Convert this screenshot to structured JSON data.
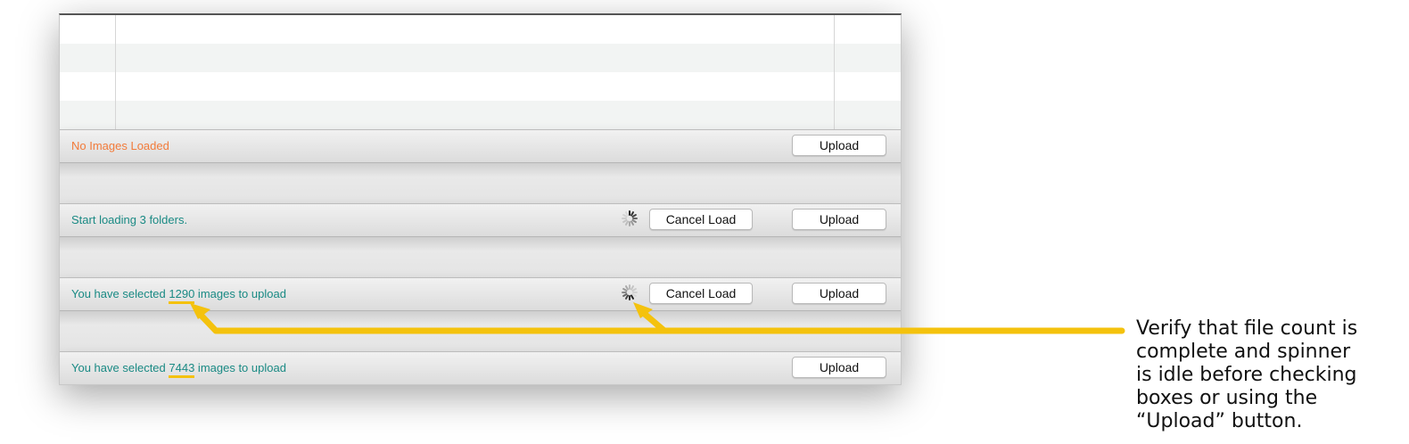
{
  "panels": [
    {
      "status": "No Images Loaded",
      "status_color": "#f27b3a",
      "show_spinner": false,
      "cancel_label": "",
      "upload_label": "Upload"
    },
    {
      "status": "Start loading 3 folders.",
      "status_color": "#1a8a84",
      "show_spinner": true,
      "cancel_label": "Cancel Load",
      "upload_label": "Upload"
    },
    {
      "status_prefix": "You have selected ",
      "count": "1290",
      "status_suffix": " images to upload",
      "status_color": "#1a8a84",
      "show_spinner": true,
      "cancel_label": "Cancel Load",
      "upload_label": "Upload"
    },
    {
      "status_prefix": "You have selected ",
      "count": "7443",
      "status_suffix": " images to upload",
      "status_color": "#1a8a84",
      "show_spinner": false,
      "cancel_label": "",
      "upload_label": "Upload"
    }
  ],
  "annotation": {
    "lines": [
      "Verify that file count is",
      "complete and spinner",
      "is idle before checking",
      "boxes or using the",
      "“Upload” button."
    ],
    "arrow_color": "#f4c20d"
  },
  "icons": {
    "spinner": "spinner-icon"
  }
}
